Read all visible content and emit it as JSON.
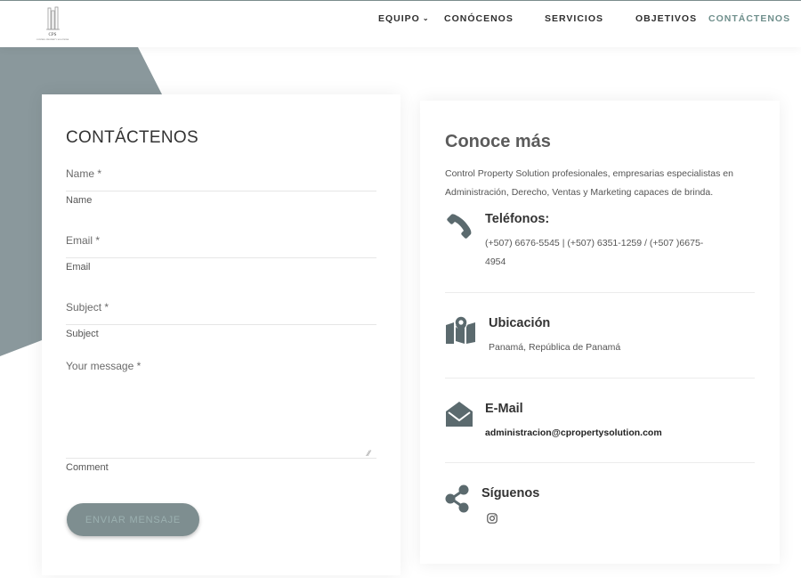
{
  "brand": {
    "logo_text": "CPS",
    "logo_subtext": "CONTROL PROPERTY SOLUTIONS"
  },
  "nav": {
    "items": [
      {
        "label": "EQUIPO",
        "has_dropdown": true
      },
      {
        "label": "CONÓCENOS"
      },
      {
        "label": "SERVICIOS"
      },
      {
        "label": "OBJETIVOS"
      },
      {
        "label": "CONTÁCTENOS",
        "active": true
      }
    ]
  },
  "colors": {
    "accent": "#6f8f8c",
    "slate": "#8a989c",
    "button": "#7e8e90"
  },
  "form": {
    "title": "CONTÁCTENOS",
    "name_label": "Name *",
    "name_help": "Name",
    "email_label": "Email *",
    "email_help": "Email",
    "subject_label": "Subject *",
    "subject_help": "Subject",
    "message_label": "Your message *",
    "message_help": "Comment",
    "submit_label": "ENVIAR MENSAJE"
  },
  "info": {
    "title": "Conoce más",
    "description": "Control Property Solution profesionales, empresarias especialistas en Administración, Derecho, Ventas y Marketing capaces de brinda.",
    "phones": {
      "title": "Teléfonos:",
      "line1": "(+507) 6676-5545 | (+507) 6351-1259 / (+507 )6675-",
      "line2": "4954",
      "icon": "phone-icon"
    },
    "location": {
      "title": "Ubicación",
      "text": "Panamá, República de Panamá",
      "icon": "map-pin-icon"
    },
    "email": {
      "title": "E-Mail",
      "text": "administracion@cpropertysolution.com",
      "icon": "envelope-open-icon"
    },
    "social": {
      "title": "Síguenos",
      "icon": "share-icon",
      "instagram_icon": "instagram-icon"
    }
  }
}
